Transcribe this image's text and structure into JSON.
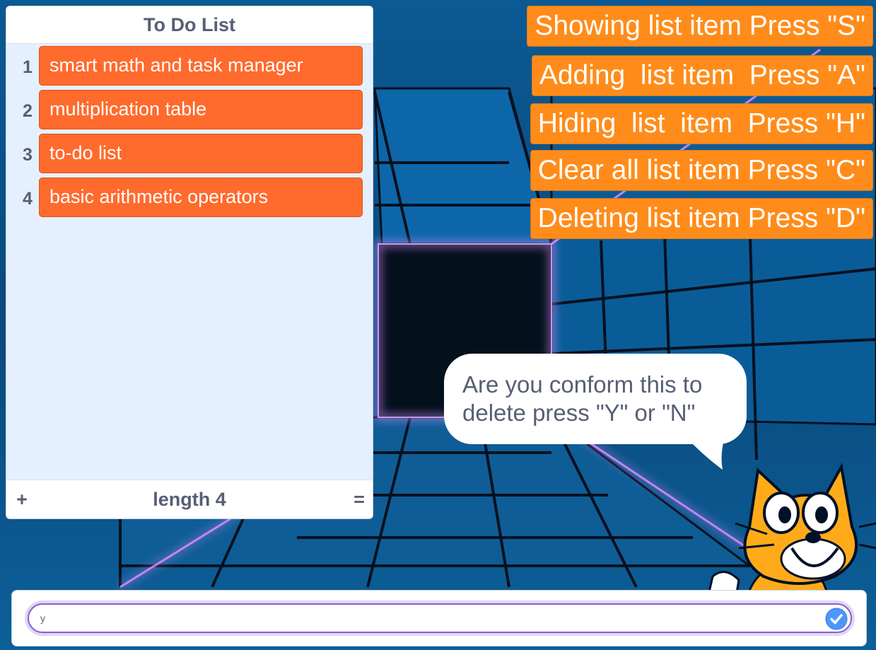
{
  "list": {
    "title": "To Do List",
    "items": [
      {
        "index": "1",
        "value": "smart math and task manager"
      },
      {
        "index": "2",
        "value": "multiplication table"
      },
      {
        "index": "3",
        "value": "to-do list"
      },
      {
        "index": "4",
        "value": "basic arithmetic operators"
      }
    ],
    "footer": {
      "add_label": "+",
      "length_label": "length 4",
      "resize_label": "="
    }
  },
  "instructions": [
    "Showing list item Press \"S\"",
    "Adding  list item  Press \"A\"",
    "Hiding  list  item  Press \"H\"",
    "Clear all list item Press \"C\"",
    "Deleting list item Press \"D\""
  ],
  "speech_bubble": {
    "text": "Are you conform this to delete press \"Y\" or \"N\""
  },
  "ask": {
    "value": "y"
  },
  "colors": {
    "list_item": "#ff6a2d",
    "instruction_label": "#ff8c1a",
    "input_focus": "#855cd6",
    "submit_button": "#4c97ff",
    "text_gray": "#575e75"
  },
  "icons": {
    "submit": "check-icon",
    "sprite": "scratch-cat-sprite"
  }
}
